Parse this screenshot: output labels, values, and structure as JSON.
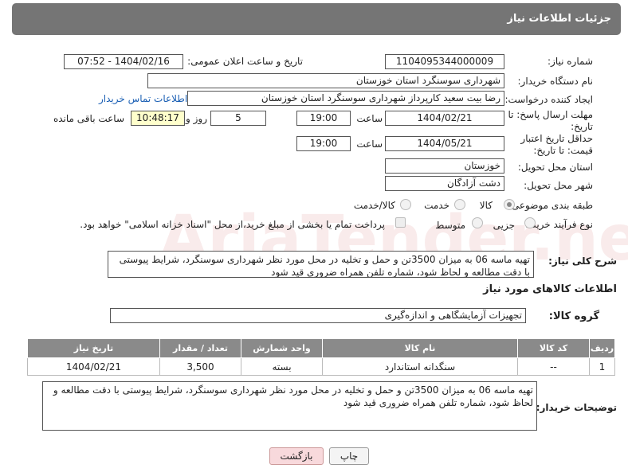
{
  "header": {
    "title": "جزئیات اطلاعات نیاز"
  },
  "watermark": {
    "text": "AriaTender.neT"
  },
  "fields": {
    "need_number_label": "شماره نیاز:",
    "need_number": "1104095344000009",
    "announce_label": "تاریخ و ساعت اعلان عمومی:",
    "announce_value": "1404/02/16 - 07:52",
    "buyer_org_label": "نام دستگاه خریدار:",
    "buyer_org": "شهرداری سوسنگرد استان خوزستان",
    "creator_label": "ایجاد کننده درخواست:",
    "creator": "رضا بیت سعید کارپرداز شهرداری سوسنگرد استان خوزستان",
    "contact_link": "اطلاعات تماس خریدار",
    "deadline_label": "مهلت ارسال پاسخ: تا تاریخ:",
    "deadline_date": "1404/02/21",
    "time_label": "ساعت",
    "deadline_time": "19:00",
    "days_value": "5",
    "days_label": "روز و",
    "remaining_time": "10:48:17",
    "remaining_label": "ساعت باقی مانده",
    "price_validity_label": "حداقل تاریخ اعتبار قیمت: تا تاریخ:",
    "price_validity_date": "1404/05/21",
    "price_validity_time": "19:00",
    "province_label": "استان محل تحویل:",
    "province": "خوزستان",
    "city_label": "شهر محل تحویل:",
    "city": "دشت آزادگان",
    "category_label": "طبقه بندی موضوعی:",
    "category_options": [
      "کالا",
      "خدمت",
      "کالا/خدمت"
    ],
    "process_label": "نوع فرآیند خرید :",
    "process_options": [
      "جزیی",
      "متوسط"
    ],
    "payment_note": "پرداخت تمام یا بخشی از مبلغ خرید،از محل \"اسناد خزانه اسلامی\" خواهد بود.",
    "description_label": "شرح کلی نیاز:",
    "description": "تهیه ماسه 06 به میزان 3500تن و حمل و تخلیه در محل مورد نظر شهرداری سوسنگرد، شرایط پیوستی با دقت مطالعه و لحاظ شود، شماره تلفن همراه ضروری قید شود"
  },
  "goods": {
    "section_title": "اطلاعات کالاهای مورد نیاز",
    "group_label": "گروه کالا:",
    "group_value": "تجهیزات آزمایشگاهی و اندازه‌گیری",
    "columns": [
      "ردیف",
      "کد کالا",
      "نام کالا",
      "واحد شمارش",
      "تعداد / مقدار",
      "تاریخ نیاز"
    ],
    "rows": [
      {
        "row": "1",
        "code": "--",
        "name": "سنگدانه استاندارد",
        "unit": "بسته",
        "qty": "3,500",
        "date": "1404/02/21"
      }
    ]
  },
  "buyer_notes": {
    "label": "توضیحات خریدار:",
    "text": "تهیه ماسه 06 به میزان 3500تن و حمل و تخلیه در محل مورد نظر شهرداری سوسنگرد، شرایط پیوستی با دقت مطالعه و لحاظ شود، شماره تلفن همراه ضروری قید شود"
  },
  "buttons": {
    "print": "چاپ",
    "back": "بازگشت"
  }
}
